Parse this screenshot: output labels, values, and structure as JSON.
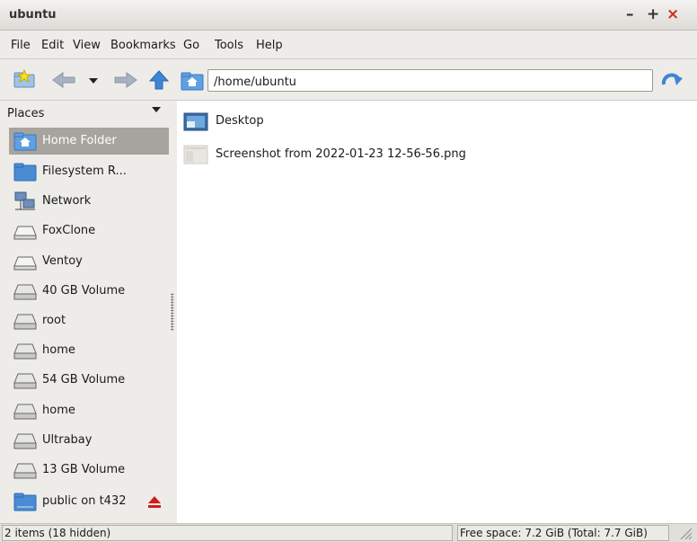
{
  "window": {
    "title": "ubuntu",
    "minimize": "–",
    "maximize": "+",
    "close": "×"
  },
  "menu": [
    "File",
    "Edit",
    "View",
    "Bookmarks",
    "Go",
    "Tools",
    "Help"
  ],
  "toolbar": {
    "path": "/home/ubuntu",
    "icons": [
      "new-tab-icon",
      "back-icon",
      "history-dropdown-icon",
      "forward-icon",
      "up-icon",
      "home-folder-icon",
      "go-icon"
    ]
  },
  "sidebar": {
    "header": "Places",
    "items": [
      {
        "label": "Home Folder",
        "icon": "home-folder-icon",
        "selected": true
      },
      {
        "label": "Filesystem R...",
        "icon": "folder-icon"
      },
      {
        "label": "Network",
        "icon": "network-icon"
      },
      {
        "label": "FoxClone",
        "icon": "drive-icon"
      },
      {
        "label": "Ventoy",
        "icon": "drive-icon"
      },
      {
        "label": "40 GB Volume",
        "icon": "hard-disk-icon"
      },
      {
        "label": "root",
        "icon": "hard-disk-icon"
      },
      {
        "label": "home",
        "icon": "hard-disk-icon"
      },
      {
        "label": "54 GB Volume",
        "icon": "hard-disk-icon"
      },
      {
        "label": "home",
        "icon": "hard-disk-icon"
      },
      {
        "label": "Ultrabay",
        "icon": "hard-disk-icon"
      },
      {
        "label": "13 GB Volume",
        "icon": "hard-disk-icon"
      },
      {
        "label": "public on t432",
        "icon": "network-share-icon",
        "eject": true
      }
    ]
  },
  "files": [
    {
      "name": "Desktop",
      "icon": "desktop-folder-icon"
    },
    {
      "name": "Screenshot from 2022-01-23 12-56-56.png",
      "icon": "image-thumbnail-icon"
    }
  ],
  "status": {
    "items": "2 items (18 hidden)",
    "free_space": "Free space: 7.2 GiB (Total: 7.7 GiB)"
  },
  "colors": {
    "selected": "#a7a39e",
    "close": "#d52b1e",
    "folder": "#4a8bd4"
  }
}
